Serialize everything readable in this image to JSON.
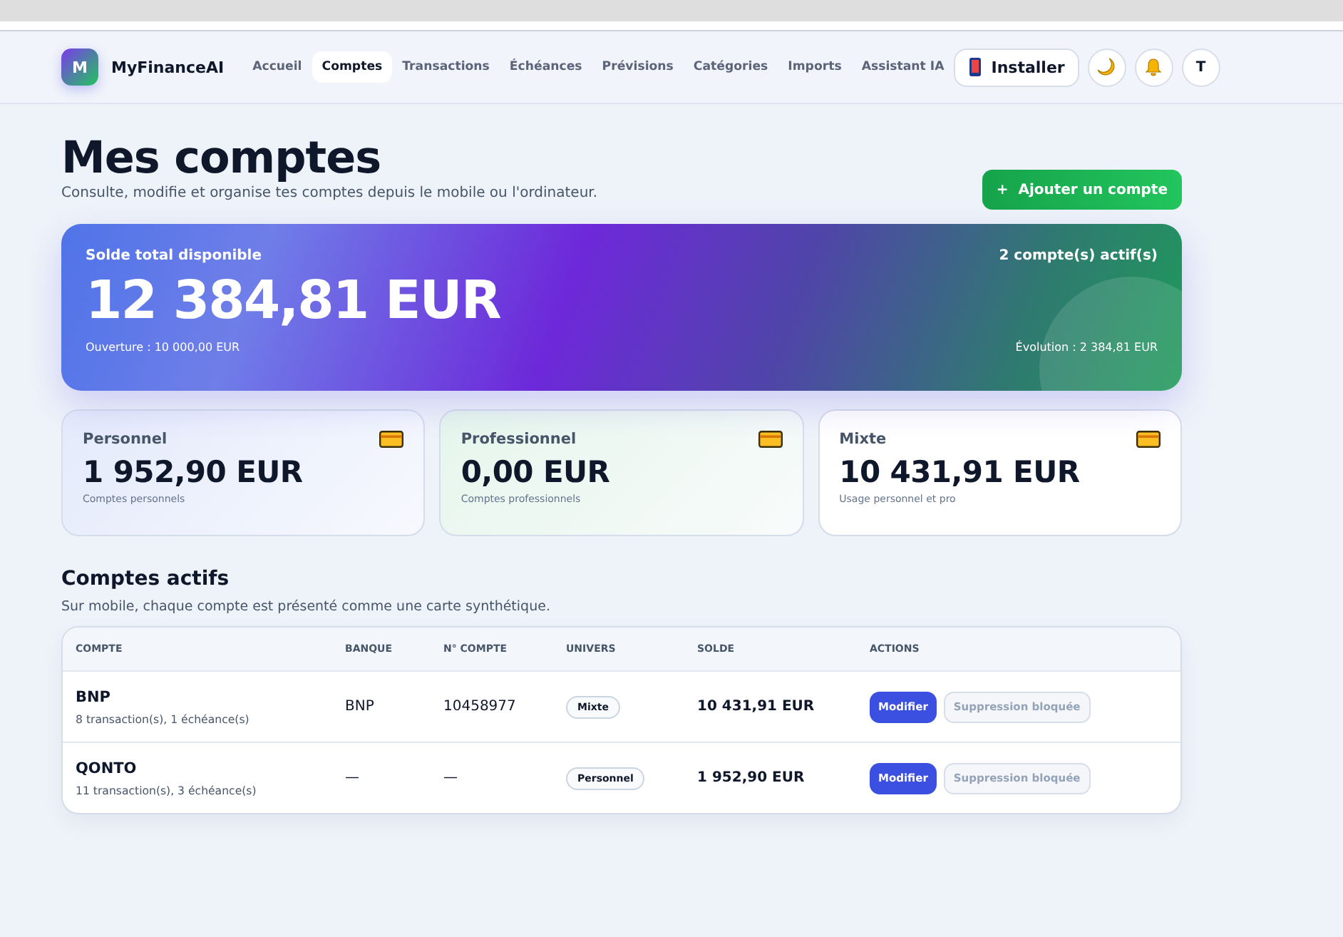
{
  "brand": {
    "logo": "M",
    "name": "MyFinanceAI"
  },
  "nav": [
    {
      "label": "Accueil",
      "selected": false
    },
    {
      "label": "Comptes",
      "selected": true
    },
    {
      "label": "Transactions",
      "selected": false
    },
    {
      "label": "Échéances",
      "selected": false
    },
    {
      "label": "Prévisions",
      "selected": false
    },
    {
      "label": "Catégories",
      "selected": false
    },
    {
      "label": "Imports",
      "selected": false
    },
    {
      "label": "Assistant IA",
      "selected": false
    }
  ],
  "header_actions": {
    "install": "Installer",
    "avatar": "T"
  },
  "page": {
    "title": "Mes comptes",
    "subtitle": "Consulte, modifie et organise tes comptes depuis le mobile ou l'ordinateur.",
    "add_button": "Ajouter un compte",
    "add_icon": "+"
  },
  "summary": {
    "label": "Solde total disponible",
    "active": "2 compte(s) actif(s)",
    "total": "12 384,81 EUR",
    "opening": "Ouverture : 10 000,00 EUR",
    "evolution": "Évolution : 2 384,81 EUR"
  },
  "categories": [
    {
      "kind": "personal",
      "title": "Personnel",
      "amount": "1 952,90 EUR",
      "note": "Comptes personnels"
    },
    {
      "kind": "pro",
      "title": "Professionnel",
      "amount": "0,00 EUR",
      "note": "Comptes professionnels"
    },
    {
      "kind": "mixed",
      "title": "Mixte",
      "amount": "10 431,91 EUR",
      "note": "Usage personnel et pro"
    }
  ],
  "accounts_section": {
    "title": "Comptes actifs",
    "subtitle": "Sur mobile, chaque compte est présenté comme une carte synthétique."
  },
  "table": {
    "columns": [
      "COMPTE",
      "BANQUE",
      "N° COMPTE",
      "UNIVERS",
      "SOLDE",
      "ACTIONS"
    ],
    "rows": [
      {
        "name": "BNP",
        "detail": "8 transaction(s), 1 échéance(s)",
        "bank": "BNP",
        "number": "10458977",
        "universe": "Mixte",
        "balance": "10 431,91 EUR",
        "edit": "Modifier",
        "delete": "Suppression bloquée",
        "delete_disabled": true
      },
      {
        "name": "QONTO",
        "detail": "11 transaction(s), 3 échéance(s)",
        "bank": "—",
        "number": "—",
        "universe": "Personnel",
        "balance": "1 952,90 EUR",
        "edit": "Modifier",
        "delete": "Suppression bloquée",
        "delete_disabled": true
      }
    ]
  }
}
